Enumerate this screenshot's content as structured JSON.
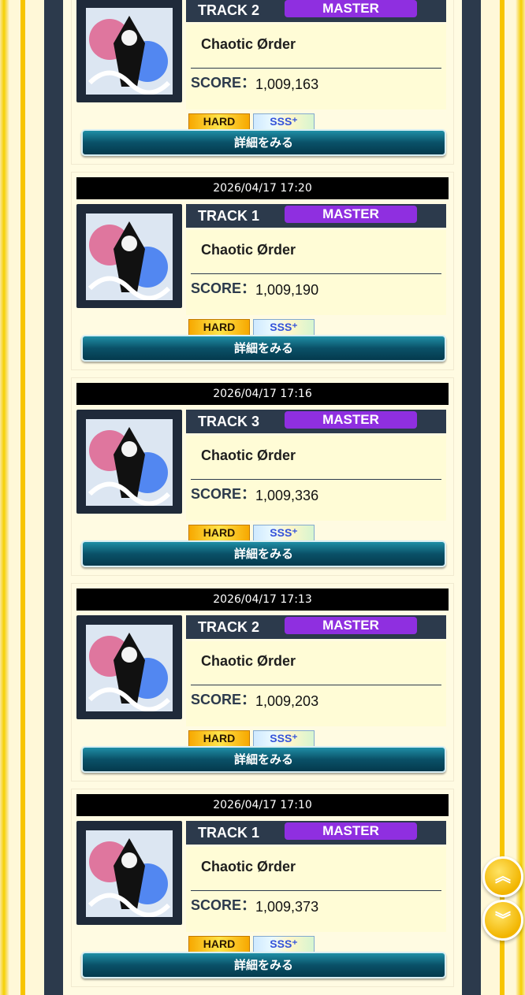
{
  "records": [
    {
      "date": "",
      "track": "TRACK 2",
      "difficulty": "MASTER",
      "title": "Chaotic Ørder",
      "score_label": "SCORE：",
      "score": "1,009,163",
      "clear": "HARD",
      "rank": "SSS⁺",
      "detail_label": "詳細をみる"
    },
    {
      "date": "2026/04/17 17:20",
      "track": "TRACK 1",
      "difficulty": "MASTER",
      "title": "Chaotic Ørder",
      "score_label": "SCORE：",
      "score": "1,009,190",
      "clear": "HARD",
      "rank": "SSS⁺",
      "detail_label": "詳細をみる"
    },
    {
      "date": "2026/04/17 17:16",
      "track": "TRACK 3",
      "difficulty": "MASTER",
      "title": "Chaotic Ørder",
      "score_label": "SCORE：",
      "score": "1,009,336",
      "clear": "HARD",
      "rank": "SSS⁺",
      "detail_label": "詳細をみる"
    },
    {
      "date": "2026/04/17 17:13",
      "track": "TRACK 2",
      "difficulty": "MASTER",
      "title": "Chaotic Ørder",
      "score_label": "SCORE：",
      "score": "1,009,203",
      "clear": "HARD",
      "rank": "SSS⁺",
      "detail_label": "詳細をみる"
    },
    {
      "date": "2026/04/17 17:10",
      "track": "TRACK 1",
      "difficulty": "MASTER",
      "title": "Chaotic Ørder",
      "score_label": "SCORE：",
      "score": "1,009,373",
      "clear": "HARD",
      "rank": "SSS⁺",
      "detail_label": "詳細をみる"
    }
  ],
  "scroll_up_icon": "double-chevron-up-icon",
  "scroll_down_icon": "double-chevron-down-icon",
  "colors": {
    "master": "#8f2fe0",
    "navy": "#2c3a4c",
    "gold": "#f7c500"
  }
}
